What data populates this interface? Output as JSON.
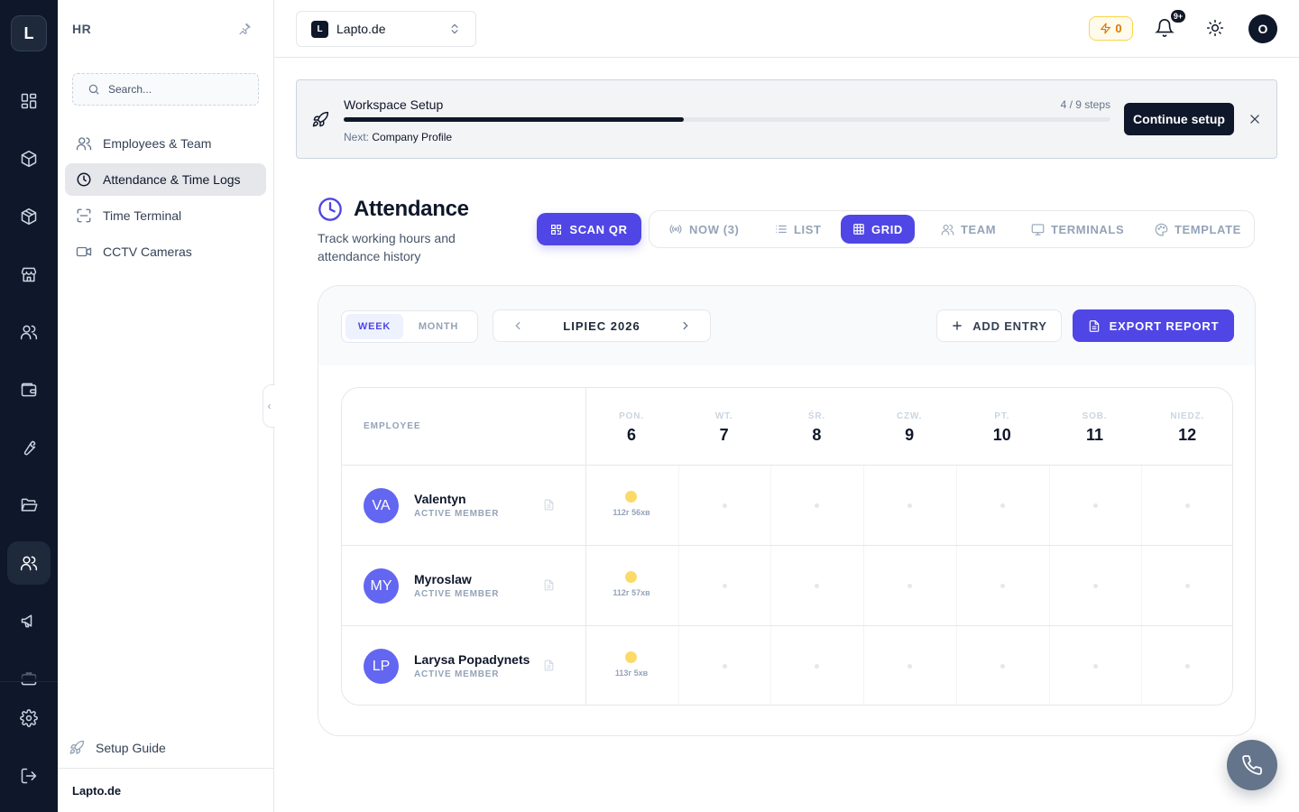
{
  "rail": {
    "logo_letter": "L",
    "icons": [
      "dashboard-icon",
      "box-icon",
      "package-icon",
      "store-icon",
      "users-icon",
      "wallet-icon",
      "wrench-icon",
      "folder-icon",
      "hr-team-icon",
      "megaphone-icon",
      "briefcase-icon",
      "settings-icon",
      "logout-icon"
    ],
    "active_icon": "hr-team-icon"
  },
  "sidebar": {
    "title": "HR",
    "search_placeholder": "Search...",
    "items": [
      {
        "label": "Employees & Team",
        "icon": "users-icon"
      },
      {
        "label": "Attendance & Time Logs",
        "icon": "clock-icon",
        "active": true
      },
      {
        "label": "Time Terminal",
        "icon": "scan-icon"
      },
      {
        "label": "CCTV Cameras",
        "icon": "video-icon"
      }
    ],
    "setup_guide": "Setup Guide",
    "footer": "Lapto.de"
  },
  "topbar": {
    "org_badge": "L",
    "org_name": "Lapto.de",
    "credits": "0",
    "notifications_badge": "9+",
    "user_initial": "O"
  },
  "banner": {
    "title": "Workspace Setup",
    "steps": "4 / 9 steps",
    "progress": 0.444,
    "next_prefix": "Next:",
    "next_step": "Company Profile",
    "button": "Continue setup"
  },
  "page": {
    "title": "Attendance",
    "subtitle": "Track working hours and attendance history",
    "scan_button": "SCAN QR",
    "tabs": [
      {
        "label": "NOW (3)",
        "icon": "broadcast-icon"
      },
      {
        "label": "LIST",
        "icon": "list-icon"
      },
      {
        "label": "GRID",
        "icon": "grid-icon",
        "active": true
      },
      {
        "label": "TEAM",
        "icon": "users-icon"
      },
      {
        "label": "TERMINALS",
        "icon": "monitor-icon"
      },
      {
        "label": "TEMPLATE",
        "icon": "palette-icon"
      }
    ]
  },
  "toolbar": {
    "view_week": "WEEK",
    "view_month": "MONTH",
    "active_view": "WEEK",
    "period_label": "LIPIEC 2026",
    "add_entry": "ADD ENTRY",
    "export_report": "EXPORT REPORT"
  },
  "grid": {
    "employee_header": "EMPLOYEE",
    "days": [
      {
        "name": "PON.",
        "num": "6"
      },
      {
        "name": "WT.",
        "num": "7"
      },
      {
        "name": "ŚR.",
        "num": "8"
      },
      {
        "name": "CZW.",
        "num": "9"
      },
      {
        "name": "PT.",
        "num": "10"
      },
      {
        "name": "SOB.",
        "num": "11"
      },
      {
        "name": "NIEDZ.",
        "num": "12"
      }
    ],
    "rows": [
      {
        "initials": "VA",
        "name": "Valentyn",
        "role": "ACTIVE MEMBER",
        "cells": [
          "112г 56хв",
          "",
          "",
          "",
          "",
          "",
          ""
        ]
      },
      {
        "initials": "MY",
        "name": "Myroslaw",
        "role": "ACTIVE MEMBER",
        "cells": [
          "112г 57хв",
          "",
          "",
          "",
          "",
          "",
          ""
        ]
      },
      {
        "initials": "LP",
        "name": "Larysa Popadynets",
        "role": "ACTIVE MEMBER",
        "cells": [
          "113г 5хв",
          "",
          "",
          "",
          "",
          "",
          ""
        ]
      }
    ]
  },
  "colors": {
    "accent": "#4f46e5",
    "rail_bg": "#0f172a",
    "present_dot": "#fcd34d",
    "avatar": "#6366f1"
  }
}
